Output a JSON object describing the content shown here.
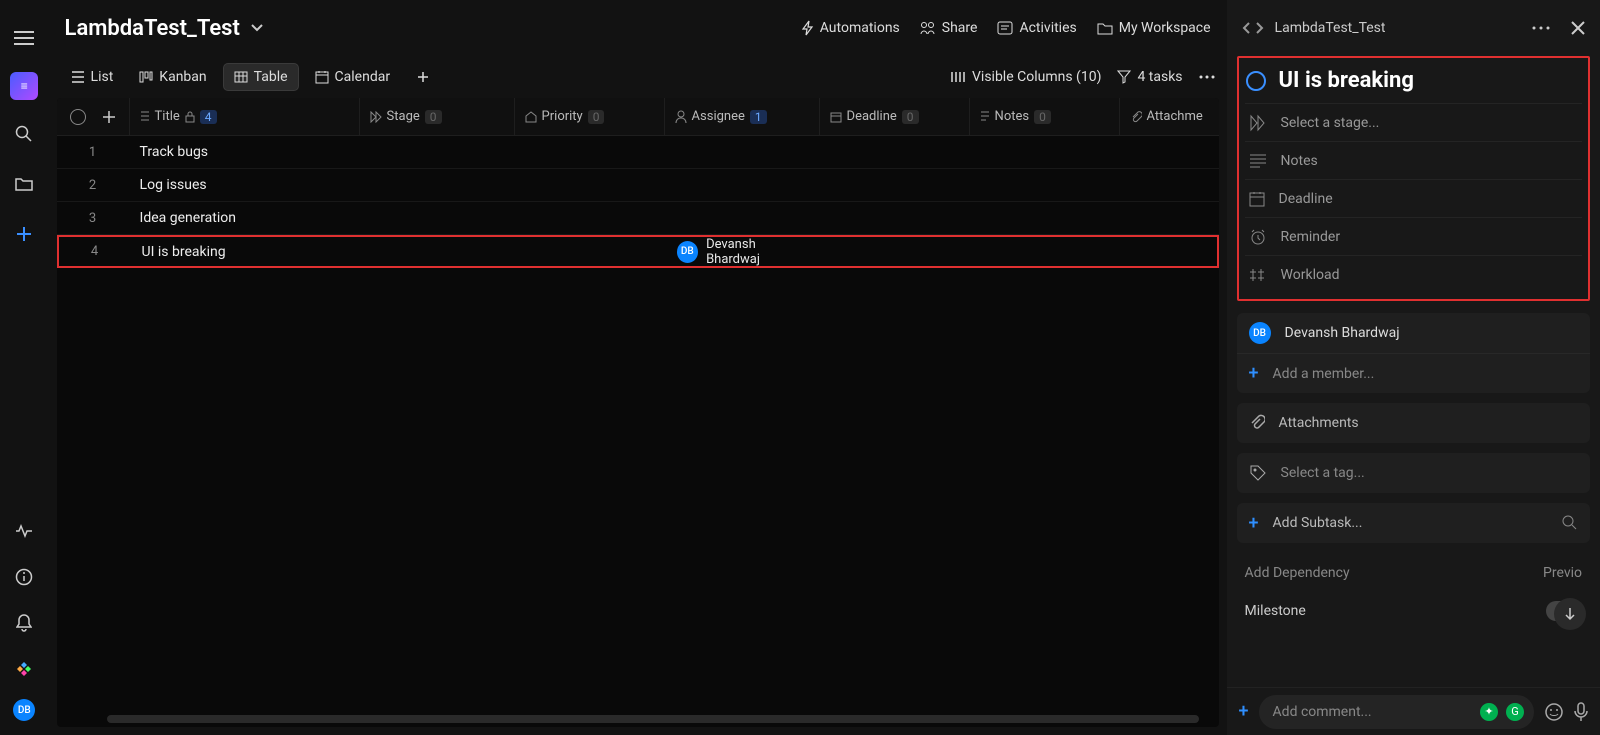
{
  "header": {
    "title": "LambdaTest_Test",
    "actions": {
      "automations": "Automations",
      "share": "Share",
      "activities": "Activities",
      "workspace": "My Workspace"
    }
  },
  "views": {
    "list": "List",
    "kanban": "Kanban",
    "table": "Table",
    "calendar": "Calendar"
  },
  "toolbar": {
    "visible_columns": "Visible Columns (10)",
    "task_count": "4 tasks"
  },
  "columns": {
    "title": "Title",
    "title_count": "4",
    "stage": "Stage",
    "stage_count": "0",
    "priority": "Priority",
    "priority_count": "0",
    "assignee": "Assignee",
    "assignee_count": "1",
    "deadline": "Deadline",
    "deadline_count": "0",
    "notes": "Notes",
    "notes_count": "0",
    "attachments": "Attachme"
  },
  "rows": [
    {
      "num": "1",
      "title": "Track bugs",
      "assignee": ""
    },
    {
      "num": "2",
      "title": "Log issues",
      "assignee": ""
    },
    {
      "num": "3",
      "title": "Idea generation",
      "assignee": ""
    },
    {
      "num": "4",
      "title": "UI is breaking",
      "assignee": "Devansh Bhardwaj",
      "assignee_initials": "DB"
    }
  ],
  "panel": {
    "breadcrumb": "LambdaTest_Test",
    "task_title": "UI is breaking",
    "fields": {
      "stage": "Select a stage...",
      "notes": "Notes",
      "deadline": "Deadline",
      "reminder": "Reminder",
      "workload": "Workload"
    },
    "member": {
      "name": "Devansh Bhardwaj",
      "initials": "DB",
      "add": "Add a member..."
    },
    "attachments": "Attachments",
    "tag": "Select a tag...",
    "subtask": "Add Subtask...",
    "dependency": "Add Dependency",
    "dependency_prev": "Previo",
    "milestone": "Milestone",
    "comment_placeholder": "Add comment..."
  }
}
